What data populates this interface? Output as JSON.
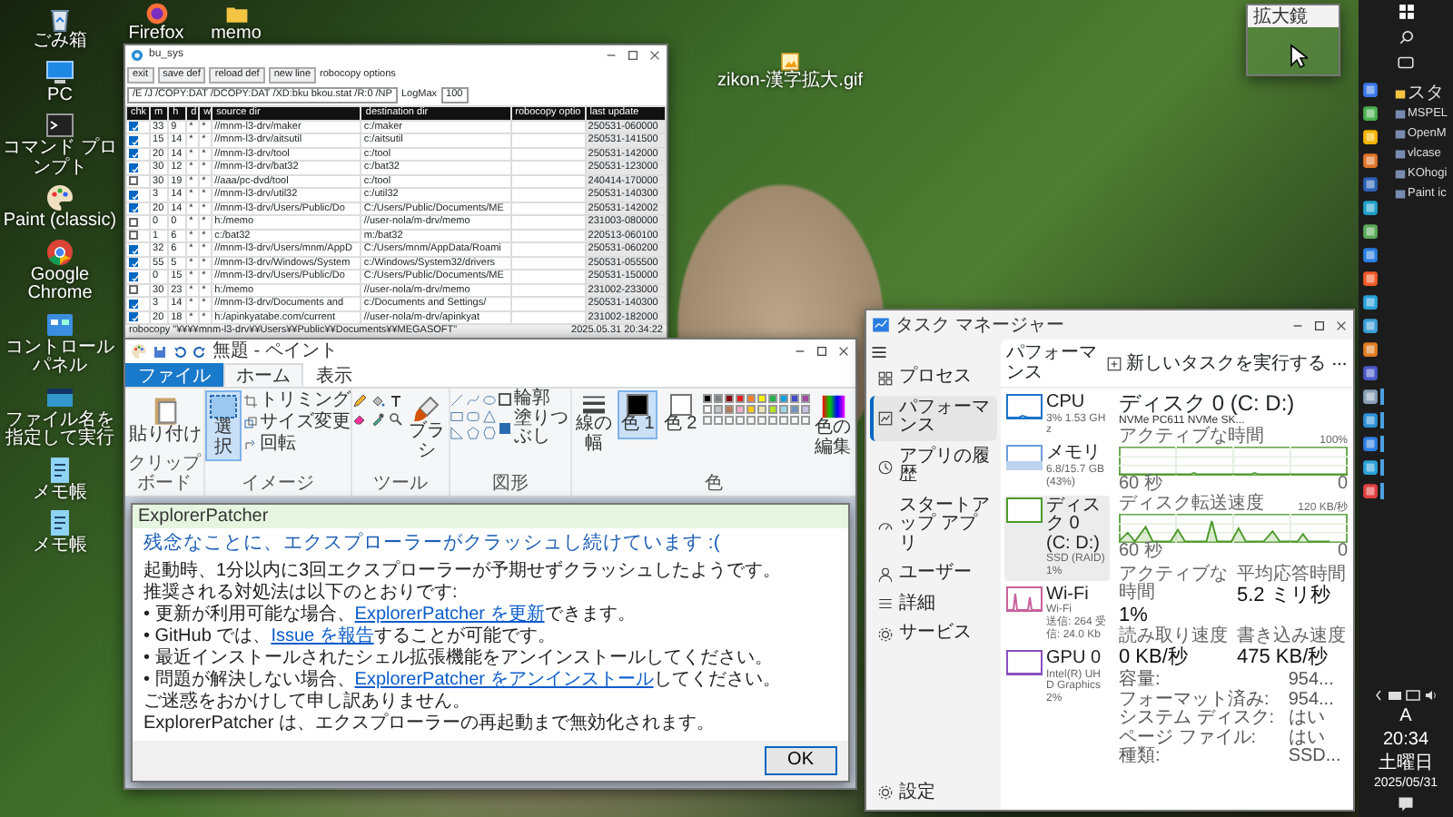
{
  "desktop_icons": [
    {
      "label": "ごみ箱",
      "kind": "recycle"
    },
    {
      "label": "PC",
      "kind": "pc"
    },
    {
      "label": "コマンド プロンプト",
      "kind": "terminal"
    },
    {
      "label": "Paint (classic)",
      "kind": "paint"
    },
    {
      "label": "Google Chrome",
      "kind": "chrome"
    },
    {
      "label": "コントロールパネル",
      "kind": "control"
    },
    {
      "label": "ファイル名を指定して実行",
      "kind": "run"
    },
    {
      "label": "メモ帳",
      "kind": "notepad"
    },
    {
      "label": "メモ帳",
      "kind": "notepad"
    }
  ],
  "top_icons": [
    {
      "label": "Firefox",
      "kind": "firefox"
    },
    {
      "label": "memo",
      "kind": "folder"
    }
  ],
  "desktop_file": {
    "label": "zikon-漢字拡大.gif",
    "kind": "gif"
  },
  "backup": {
    "title": "bu_sys",
    "buttons": [
      "exit",
      "save def",
      "reload def",
      "new line"
    ],
    "options_label": "robocopy options",
    "options_value": "/E /J /COPY:DAT /DCOPY:DAT /XD:bku bkou.stat /R:0 /NP",
    "logmax_label": "LogMax",
    "logmax_value": "100",
    "columns": [
      "chk",
      "m",
      "h",
      "d",
      "w",
      "source dir",
      "destination dir",
      "robocopy optio",
      "last update"
    ],
    "rows": [
      {
        "checked": true,
        "m": "33",
        "h": "9",
        "d": "*",
        "w": "*",
        "source": "//mnm-l3-drv/maker",
        "destination": "c:/maker",
        "last_update": "250531-060000"
      },
      {
        "checked": true,
        "m": "15",
        "h": "14",
        "d": "*",
        "w": "*",
        "source": "//mnm-l3-drv/aitsutil",
        "destination": "c:/aitsutil",
        "last_update": "250531-141500"
      },
      {
        "checked": true,
        "m": "20",
        "h": "14",
        "d": "*",
        "w": "*",
        "source": "//mnm-l3-drv/tool",
        "destination": "c:/tool",
        "last_update": "250531-142000"
      },
      {
        "checked": true,
        "m": "30",
        "h": "12",
        "d": "*",
        "w": "*",
        "source": "//mnm-l3-drv/bat32",
        "destination": "c:/bat32",
        "last_update": "250531-123000"
      },
      {
        "checked": false,
        "m": "30",
        "h": "19",
        "d": "*",
        "w": "*",
        "source": "//aaa/pc-dvd/tool",
        "destination": "c:/tool",
        "last_update": "240414-170000"
      },
      {
        "checked": true,
        "m": "3",
        "h": "14",
        "d": "*",
        "w": "*",
        "source": "//mnm-l3-drv/util32",
        "destination": "c:/util32",
        "last_update": "250531-140300"
      },
      {
        "checked": true,
        "m": "20",
        "h": "14",
        "d": "*",
        "w": "*",
        "source": "//mnm-l3-drv/Users/Public/Do",
        "destination": "C:/Users/Public/Documents/ME",
        "last_update": "250531-142002"
      },
      {
        "checked": false,
        "m": "0",
        "h": "0",
        "d": "*",
        "w": "*",
        "source": "h:/memo",
        "destination": "//user-nola/m-drv/memo",
        "last_update": "231003-080000"
      },
      {
        "checked": false,
        "m": "1",
        "h": "6",
        "d": "*",
        "w": "*",
        "source": "c:/bat32",
        "destination": "m:/bat32",
        "last_update": "220513-060100"
      },
      {
        "checked": true,
        "m": "32",
        "h": "6",
        "d": "*",
        "w": "*",
        "source": "//mnm-l3-drv/Users/mnm/AppD",
        "destination": "C:/Users/mnm/AppData/Roami",
        "last_update": "250531-060200"
      },
      {
        "checked": true,
        "m": "55",
        "h": "5",
        "d": "*",
        "w": "*",
        "source": "//mnm-l3-drv/Windows/System",
        "destination": "c:/Windows/System32/drivers",
        "last_update": "250531-055500"
      },
      {
        "checked": true,
        "m": "0",
        "h": "15",
        "d": "*",
        "w": "*",
        "source": "//mnm-l3-drv/Users/Public/Do",
        "destination": "C:/Users/Public/Documents/ME",
        "last_update": "250531-150000"
      },
      {
        "checked": false,
        "m": "30",
        "h": "23",
        "d": "*",
        "w": "*",
        "source": "h:/memo",
        "destination": "//user-nola/m-drv/memo",
        "last_update": "231002-233000"
      },
      {
        "checked": true,
        "m": "3",
        "h": "14",
        "d": "*",
        "w": "*",
        "source": "//mnm-l3-drv/Documents and",
        "destination": "c:/Documents and Settings/",
        "last_update": "250531-140300"
      },
      {
        "checked": true,
        "m": "20",
        "h": "18",
        "d": "*",
        "w": "*",
        "source": "h:/apinkyatabe.com/current",
        "destination": "//user-nola/m-drv/apinkyat",
        "last_update": "231002-182000"
      }
    ],
    "status_command": "robocopy \"¥¥¥¥mnm-l3-drv¥¥Users¥¥Public¥¥Documents¥¥MEGASOFT\"",
    "status_time": "2025.05.31 20:34:22"
  },
  "paint": {
    "title": "無題 - ペイント",
    "tabs": [
      {
        "label": "ファイル",
        "kind": "file",
        "selected": false
      },
      {
        "label": "ホーム",
        "kind": "tab",
        "selected": true
      },
      {
        "label": "表示",
        "kind": "tab",
        "selected": false
      }
    ],
    "ribbon": {
      "clipboard": {
        "label": "クリップボード",
        "paste": "貼り付け"
      },
      "image": {
        "label": "イメージ",
        "select": "選択",
        "tools": [
          "トリミング",
          "サイズ変更",
          "回転"
        ]
      },
      "tools": {
        "label": "ツール",
        "brush": "ブラシ"
      },
      "shapes": {
        "label": "図形",
        "outline": "輪郭",
        "fill": "塗りつぶし"
      },
      "colors": {
        "label": "色",
        "size": "線の幅",
        "edit": "色の編集",
        "swatches": [
          {
            "label": "色 1",
            "color": "#000000",
            "selected": true
          },
          {
            "label": "色 2",
            "color": "#ffffff",
            "selected": false
          }
        ],
        "palette": [
          {
            "color": "#000000"
          },
          {
            "color": "#7f7f7f"
          },
          {
            "color": "#880015"
          },
          {
            "color": "#ed1c24"
          },
          {
            "color": "#ff7f27"
          },
          {
            "color": "#fff200"
          },
          {
            "color": "#22b14c"
          },
          {
            "color": "#00a2e8"
          },
          {
            "color": "#3f48cc"
          },
          {
            "color": "#a349a4"
          },
          {
            "color": "#ffffff"
          },
          {
            "color": "#c3c3c3"
          },
          {
            "color": "#b97a57"
          },
          {
            "color": "#ffaec9"
          },
          {
            "color": "#ffc90e"
          },
          {
            "color": "#efe4b0"
          },
          {
            "color": "#b5e61d"
          },
          {
            "color": "#99d9ea"
          },
          {
            "color": "#7092be"
          },
          {
            "color": "#c8bfe7"
          }
        ]
      }
    }
  },
  "dialog": {
    "title": "ExplorerPatcher",
    "heading": "残念なことに、エクスプローラーがクラッシュし続けています :(",
    "paragraphs": [
      [
        {
          "text": "起動時、1分以内に3回エクスプローラーが予期せずクラッシュしたようです。",
          "link": false
        }
      ],
      [
        {
          "text": "推奨される対処法は以下のとおりです:",
          "link": false
        }
      ],
      [
        {
          "text": "• 更新が利用可能な場合、",
          "link": false
        },
        {
          "text": "ExplorerPatcher を更新",
          "link": true
        },
        {
          "text": "できます。",
          "link": false
        }
      ],
      [
        {
          "text": "• GitHub では、",
          "link": false
        },
        {
          "text": "Issue を報告",
          "link": true
        },
        {
          "text": "することが可能です。",
          "link": false
        }
      ],
      [
        {
          "text": "• 最近インストールされたシェル拡張機能をアンインストールしてください。",
          "link": false
        }
      ],
      [
        {
          "text": "• 問題が解決しない場合、",
          "link": false
        },
        {
          "text": "ExplorerPatcher をアンインストール",
          "link": true
        },
        {
          "text": "してください。",
          "link": false
        }
      ],
      [
        {
          "text": "ご迷惑をおかけして申し訳ありません。",
          "link": false
        }
      ],
      [
        {
          "text": "ExplorerPatcher は、エクスプローラーの再起動まで無効化されます。",
          "link": false
        }
      ]
    ],
    "button": "OK"
  },
  "task_manager": {
    "title": "タスク マネージャー",
    "nav": [
      {
        "label": "プロセス",
        "kind": "processes",
        "selected": false
      },
      {
        "label": "パフォーマンス",
        "kind": "performance",
        "selected": true
      },
      {
        "label": "アプリの履歴",
        "kind": "history",
        "selected": false
      },
      {
        "label": "スタートアップ アプリ",
        "kind": "startup",
        "selected": false
      },
      {
        "label": "ユーザー",
        "kind": "users",
        "selected": false
      },
      {
        "label": "詳細",
        "kind": "details",
        "selected": false
      },
      {
        "label": "サービス",
        "kind": "services",
        "selected": false
      }
    ],
    "settings": "設定",
    "page_title": "パフォーマンス",
    "run_task": "新しいタスクを実行する",
    "devices": [
      {
        "name": "CPU",
        "details": [
          "3% 1.53 GHz"
        ],
        "kind": "cpu",
        "selected": false
      },
      {
        "name": "メモリ",
        "details": [
          "6.8/15.7 GB (43%)"
        ],
        "kind": "memory",
        "selected": false
      },
      {
        "name": "ディスク 0 (C: D:)",
        "details": [
          "SSD (RAID)",
          "1%"
        ],
        "kind": "disk",
        "selected": true
      },
      {
        "name": "Wi-Fi",
        "details": [
          "Wi-Fi",
          "送信: 264 受信: 24.0 Kb"
        ],
        "kind": "wifi",
        "selected": false
      },
      {
        "name": "GPU 0",
        "details": [
          "Intel(R) UHD Graphics",
          "2%"
        ],
        "kind": "gpu",
        "selected": false
      }
    ],
    "detail": {
      "title": "ディスク 0 (C: D:)",
      "model": "NVMe PC611 NVMe SK...",
      "charts": [
        {
          "label": "アクティブな時間",
          "max": "100%",
          "time": "60 秒",
          "min": "0",
          "kind": "flat"
        },
        {
          "label": "ディスク転送速度",
          "max": "120 KB/秒",
          "time": "60 秒",
          "min": "0",
          "kind": "spiky"
        }
      ],
      "stats": [
        {
          "label": "アクティブな時間",
          "value": "1%"
        },
        {
          "label": "平均応答時間",
          "value": "5.2 ミリ秒"
        },
        {
          "label": "読み取り速度",
          "value": "0 KB/秒"
        },
        {
          "label": "書き込み速度",
          "value": "475 KB/秒"
        }
      ],
      "info": [
        {
          "label": "容量:",
          "value": "954..."
        },
        {
          "label": "フォーマット済み:",
          "value": "954..."
        },
        {
          "label": "システム ディスク:",
          "value": "はい"
        },
        {
          "label": "ページ ファイル:",
          "value": "はい"
        },
        {
          "label": "種類:",
          "value": "SSD..."
        }
      ]
    }
  },
  "magnifier": {
    "title": "拡大鏡"
  },
  "taskbar": {
    "jump_list": [
      {
        "label": "スタ"
      },
      {
        "label": "MSPEL"
      },
      {
        "label": "OpenM"
      },
      {
        "label": "vlcase"
      },
      {
        "label": "KOhogi"
      },
      {
        "label": "Paint ic"
      }
    ],
    "pinned": [
      {
        "running": false
      },
      {
        "running": false
      },
      {
        "running": false
      },
      {
        "running": false
      },
      {
        "running": false
      },
      {
        "running": false
      },
      {
        "running": false
      },
      {
        "running": false
      },
      {
        "running": false
      },
      {
        "running": false
      },
      {
        "running": false
      },
      {
        "running": false
      },
      {
        "running": false
      },
      {
        "running": true
      },
      {
        "running": true
      },
      {
        "running": true
      },
      {
        "running": true
      },
      {
        "running": true
      }
    ],
    "ime": "A",
    "clock": [
      "20:34",
      "土曜日",
      "2025/05/31"
    ]
  }
}
